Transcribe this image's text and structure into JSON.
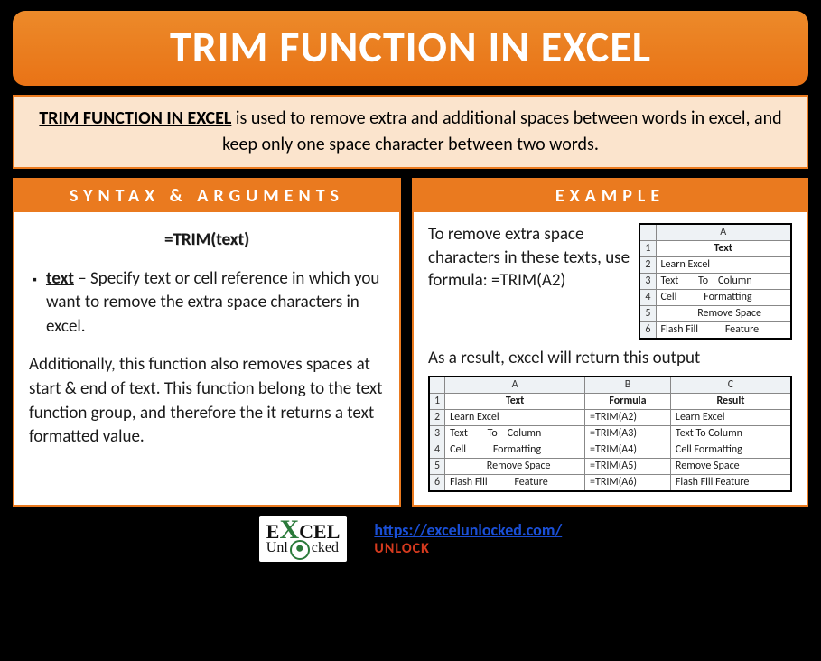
{
  "title": "TRIM FUNCTION IN EXCEL",
  "intro": {
    "strong": "TRIM FUNCTION IN EXCEL",
    "rest": " is used to remove extra and additional spaces between words in excel, and keep only one space character between two words."
  },
  "syntax": {
    "heading": "SYNTAX & ARGUMENTS",
    "formula": "=TRIM(text)",
    "arg_name": "text",
    "arg_desc": " – Specify text or cell reference in which you want to remove the extra space characters in excel.",
    "para": "Additionally, this function also removes spaces at start & end of text. This function belong to the text function group, and therefore the it returns a text formatted value."
  },
  "example": {
    "heading": "EXAMPLE",
    "intro_text": "To remove extra space characters in these texts, use formula: =TRIM(A2)",
    "result_text": "As a result, excel will return this output",
    "table1": {
      "col": "A",
      "header": "Text",
      "rows": [
        {
          "n": "2",
          "a": "Learn Excel"
        },
        {
          "n": "3",
          "a": "Text        To    Column"
        },
        {
          "n": "4",
          "a": "Cell           Formatting"
        },
        {
          "n": "5",
          "a": "               Remove Space"
        },
        {
          "n": "6",
          "a": "Flash Fill           Feature"
        }
      ]
    },
    "table2": {
      "cols": {
        "a": "A",
        "b": "B",
        "c": "C"
      },
      "headers": {
        "a": "Text",
        "b": "Formula",
        "c": "Result"
      },
      "rows": [
        {
          "n": "2",
          "a": "Learn Excel",
          "b": "=TRIM(A2)",
          "c": "Learn Excel"
        },
        {
          "n": "3",
          "a": "Text        To    Column",
          "b": "=TRIM(A3)",
          "c": "Text To Column"
        },
        {
          "n": "4",
          "a": "Cell           Formatting",
          "b": "=TRIM(A4)",
          "c": "Cell Formatting"
        },
        {
          "n": "5",
          "a": "               Remove Space",
          "b": "=TRIM(A5)",
          "c": "Remove Space"
        },
        {
          "n": "6",
          "a": "Flash Fill           Feature",
          "b": "=TRIM(A6)",
          "c": "Flash Fill Feature"
        }
      ]
    }
  },
  "footer": {
    "logo_x": "X",
    "logo_rest": "CEL",
    "logo_e": "E",
    "logo_sub": "Unlocked",
    "url": "https://excelunlocked.com/",
    "unlock": "UNLOCK"
  }
}
